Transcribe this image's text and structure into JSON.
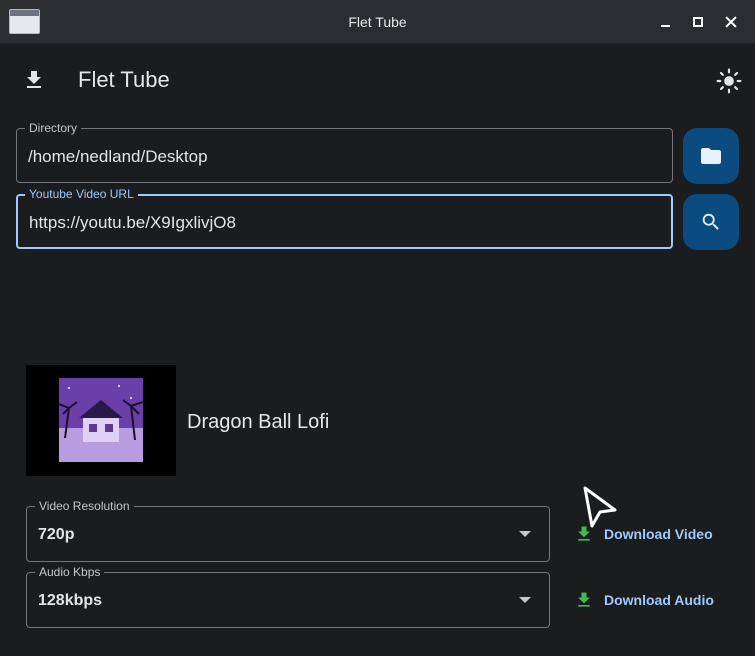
{
  "window": {
    "title": "Flet Tube"
  },
  "appbar": {
    "title": "Flet Tube",
    "leading_icon": "download-icon",
    "theme_icon": "light-mode-icon"
  },
  "directory": {
    "label": "Directory",
    "value": "/home/nedland/Desktop"
  },
  "url": {
    "label": "Youtube Video URL",
    "value": "https://youtu.be/X9IgxlivjO8"
  },
  "video": {
    "title": "Dragon Ball Lofi"
  },
  "resolution": {
    "label": "Video Resolution",
    "value": "720p"
  },
  "kbps": {
    "label": "Audio Kbps",
    "value": "128kbps"
  },
  "actions": {
    "download_video": "Download Video",
    "download_audio": "Download Audio"
  },
  "colors": {
    "accent": "#9ecaff",
    "button_bg": "#0b4b80",
    "download_icon": "#3fb950",
    "background": "#1a1c1e"
  }
}
